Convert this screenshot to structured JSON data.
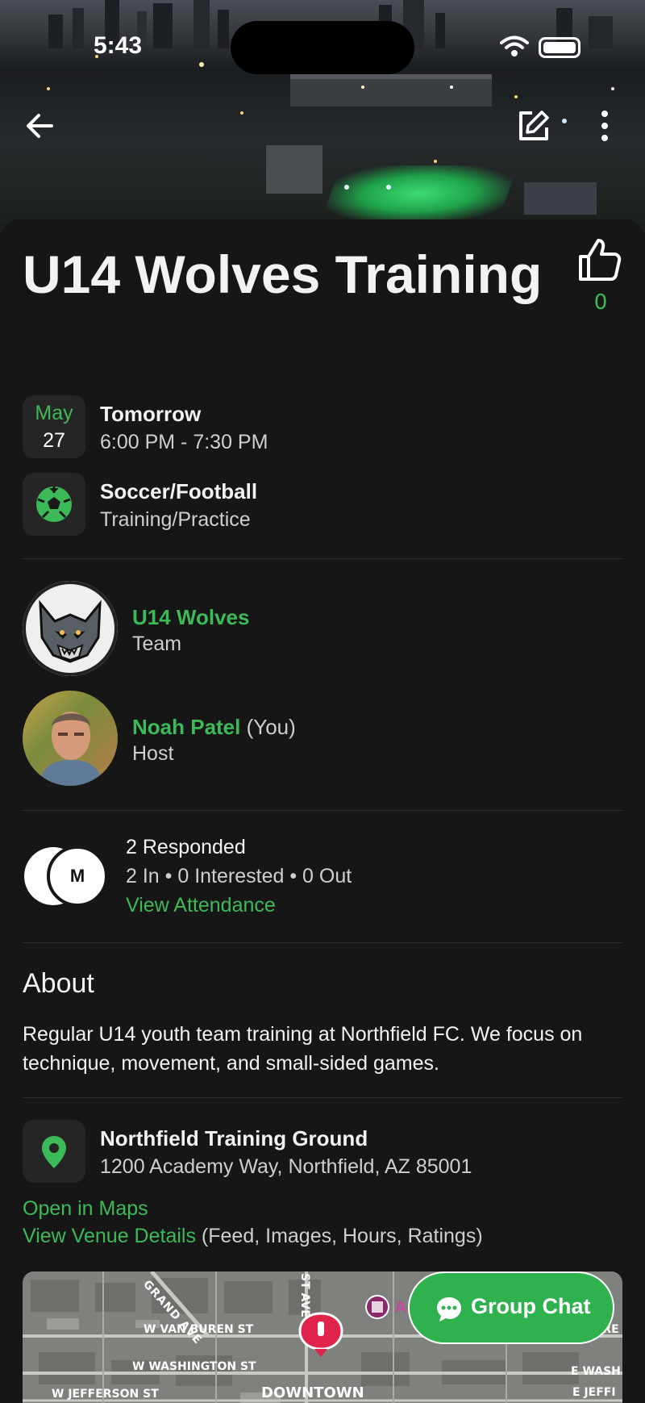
{
  "status_bar": {
    "time": "5:43"
  },
  "header": {
    "back_icon": "arrow-left-icon",
    "edit_icon": "edit-icon",
    "more_icon": "more-vertical-icon"
  },
  "event": {
    "title": "U14 Wolves Training",
    "likes": "0",
    "date": {
      "month": "May",
      "day": "27",
      "label": "Tomorrow",
      "time_range": "6:00 PM - 7:30 PM"
    },
    "sport": {
      "name": "Soccer/Football",
      "type": "Training/Practice"
    }
  },
  "team": {
    "name": "U14 Wolves",
    "role": "Team"
  },
  "host": {
    "name": "Noah Patel",
    "you_label": "(You)",
    "role": "Host"
  },
  "attendance": {
    "responded": "2 Responded",
    "summary": "2 In • 0 Interested • 0 Out",
    "avatar_initial": "M",
    "view_link": "View Attendance"
  },
  "about": {
    "title": "About",
    "body": "Regular U14 youth team training at Northfield FC. We focus on technique, movement, and small-sided games."
  },
  "venue": {
    "name": "Northfield Training Ground",
    "address": "1200 Academy Way, Northfield, AZ 85001",
    "open_maps": "Open in Maps",
    "view_details": "View Venue Details",
    "details_hint": "(Feed, Images, Hours, Ratings)"
  },
  "map_labels": {
    "grand_ave": "GRAND AVE",
    "st_ave": "ST AVE",
    "van_buren": "W VAN BUREN ST",
    "washington": "W WASHINGTON ST",
    "jefferson": "W JEFFERSON ST",
    "downtown": "DOWNTOWN",
    "e_wash": "E WASH",
    "e_jeff": "E JEFFI",
    "ure": "URE",
    "poi_letter": "A"
  },
  "group_chat": {
    "label": "Group Chat"
  },
  "colors": {
    "accent": "#3dba58",
    "background": "#161616",
    "tile": "#252525"
  }
}
